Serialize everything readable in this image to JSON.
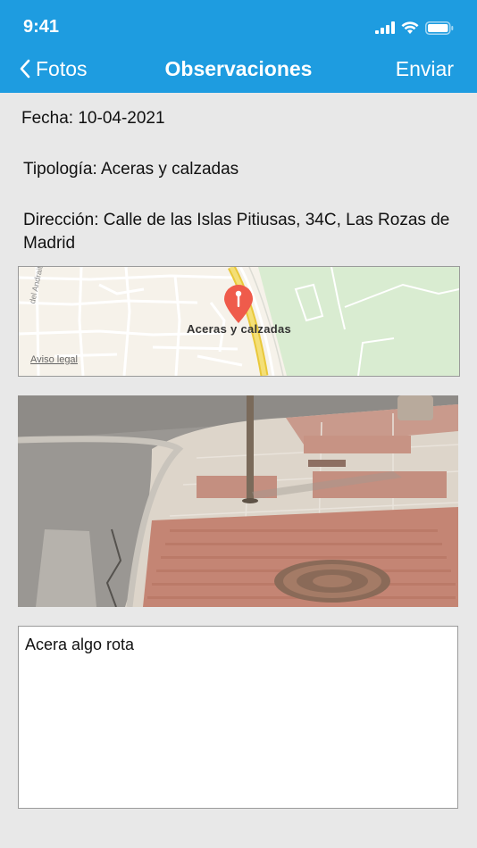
{
  "status_bar": {
    "time": "9:41"
  },
  "nav": {
    "back_label": "Fotos",
    "title": "Observaciones",
    "send_label": "Enviar"
  },
  "fields": {
    "date": "Fecha: 10-04-2021",
    "type": "Tipología: Aceras y calzadas",
    "address": "Dirección: Calle de las Islas Pitiusas, 34C, Las Rozas de Madrid"
  },
  "map": {
    "pin_label": "Aceras y calzadas",
    "legal_link": "Aviso legal",
    "street_label": "del Andraitx"
  },
  "observation": {
    "text": "Acera algo rota"
  },
  "colors": {
    "accent": "#1e9ce0",
    "background": "#e8e8e8",
    "pin": "#ef5b4b"
  }
}
